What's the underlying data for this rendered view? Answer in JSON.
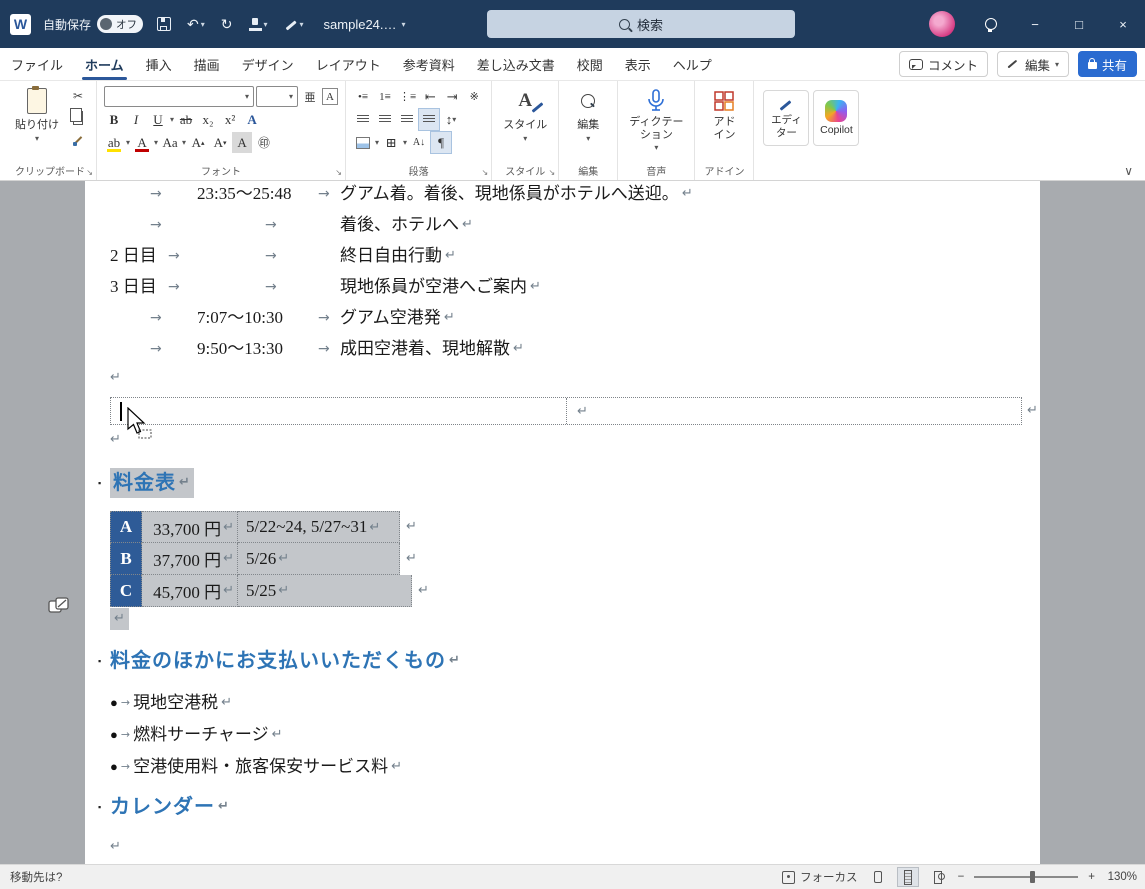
{
  "titlebar": {
    "autosave_label": "自動保存",
    "autosave_state": "オフ",
    "doc_name": "sample24.…",
    "search_label": "検索",
    "logo_letter": "W",
    "undo_glyph": "↶",
    "redo_glyph": "↻",
    "window": {
      "minimize": "−",
      "maximize": "□",
      "close": "×"
    }
  },
  "ribbon": {
    "tabs": [
      "ファイル",
      "ホーム",
      "挿入",
      "描画",
      "デザイン",
      "レイアウト",
      "参考資料",
      "差し込み文書",
      "校閲",
      "表示",
      "ヘルプ"
    ],
    "right": {
      "comments": "コメント",
      "editing": "編集",
      "share": "共有"
    },
    "clipboard": {
      "paste": "貼り付け"
    },
    "font": {
      "name_value": "",
      "size_value": "",
      "bold": "B",
      "italic": "I",
      "underline": "U",
      "strike": "ab",
      "subscript": "x₂",
      "superscript": "x²",
      "effects": "A",
      "phonetic": "亜",
      "char_border": "A",
      "highlight": "ab",
      "font_color": "A",
      "change_case": "Aa",
      "grow": "A",
      "shrink": "A",
      "char_shade": "A",
      "enclose": "㊞"
    },
    "paragraph": {
      "bullets": "•≡",
      "numbering": "1≡",
      "multilevel": "⋮≡",
      "outdent": "⇤",
      "indent": "⇥",
      "ext_format": "※",
      "spacing": "↕",
      "borders": "⊞",
      "sort": "A↓",
      "pilcrow": "¶"
    },
    "styles_label": "スタイル",
    "editing_label": "編集",
    "dictation_label": "ディクテー\nション",
    "addins_label": "アド\nイン",
    "editor_label": "エディ\nター",
    "copilot_label": "Copilot",
    "group_labels": {
      "clipboard": "クリップボード",
      "font": "フォント",
      "paragraph": "段落",
      "styles": "スタイル",
      "voice": "音声",
      "addins": "アドイン"
    }
  },
  "document": {
    "schedule_lines": [
      {
        "day": "",
        "time": "23:35〜25:48",
        "desc": "グアム着。着後、現地係員がホテルへ送迎。"
      },
      {
        "day": "",
        "time": "",
        "desc": "着後、ホテルへ"
      },
      {
        "day": "2 日目",
        "time": "",
        "desc": "終日自由行動"
      },
      {
        "day": "3 日目",
        "time": "",
        "desc": "現地係員が空港へご案内"
      },
      {
        "day": "",
        "time": "7:07〜10:30",
        "desc": "グアム空港発"
      },
      {
        "day": "",
        "time": "9:50〜13:30",
        "desc": "成田空港着、現地解散"
      }
    ],
    "heading_price": "料金表",
    "price_table": [
      {
        "grade": "A",
        "price": "33,700 円",
        "dates": "5/22~24, 5/27~31"
      },
      {
        "grade": "B",
        "price": "37,700 円",
        "dates": "5/26"
      },
      {
        "grade": "C",
        "price": "45,700 円",
        "dates": "5/25"
      }
    ],
    "heading_extra": "料金のほかにお支払いいただくもの",
    "extra_items": [
      "現地空港税",
      "燃料サーチャージ",
      "空港使用料・旅客保安サービス料"
    ],
    "heading_calendar": "カレンダー"
  },
  "marks": {
    "tab": "→",
    "para": "↵",
    "bullet": "●",
    "caret": "▾",
    "caret_up": "▴",
    "outline": "▪",
    "launcher": "↘",
    "collapse": "∨"
  },
  "statusbar": {
    "left": "移動先は?",
    "focus": "フォーカス",
    "zoom_out": "−",
    "zoom_in": "+",
    "zoom": "130%"
  }
}
